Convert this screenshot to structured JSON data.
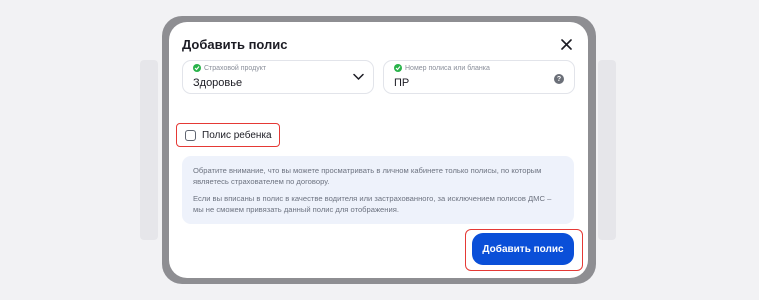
{
  "modal": {
    "title": "Добавить полис",
    "product_field": {
      "label": "Страховой продукт",
      "value": "Здоровье"
    },
    "policy_field": {
      "label": "Номер полиса или бланка",
      "value": "ПР"
    },
    "child_checkbox": {
      "label": "Полис ребенка",
      "checked": false
    },
    "info": {
      "paragraph1": "Обратите внимание, что вы можете просматривать в личном кабинете только полисы, по которым являетесь страхователем по договору.",
      "paragraph2": "Если вы вписаны в полис в качестве водителя или застрахованного, за исключением полисов ДМС – мы не сможем привязать данный полис для отображения."
    },
    "submit_label": "Добавить полис"
  },
  "colors": {
    "accent": "#0a4fd8",
    "highlight": "#e53935",
    "success": "#29b34a"
  },
  "icons": [
    "close-icon",
    "chevron-down-icon",
    "help-icon",
    "check-icon"
  ]
}
